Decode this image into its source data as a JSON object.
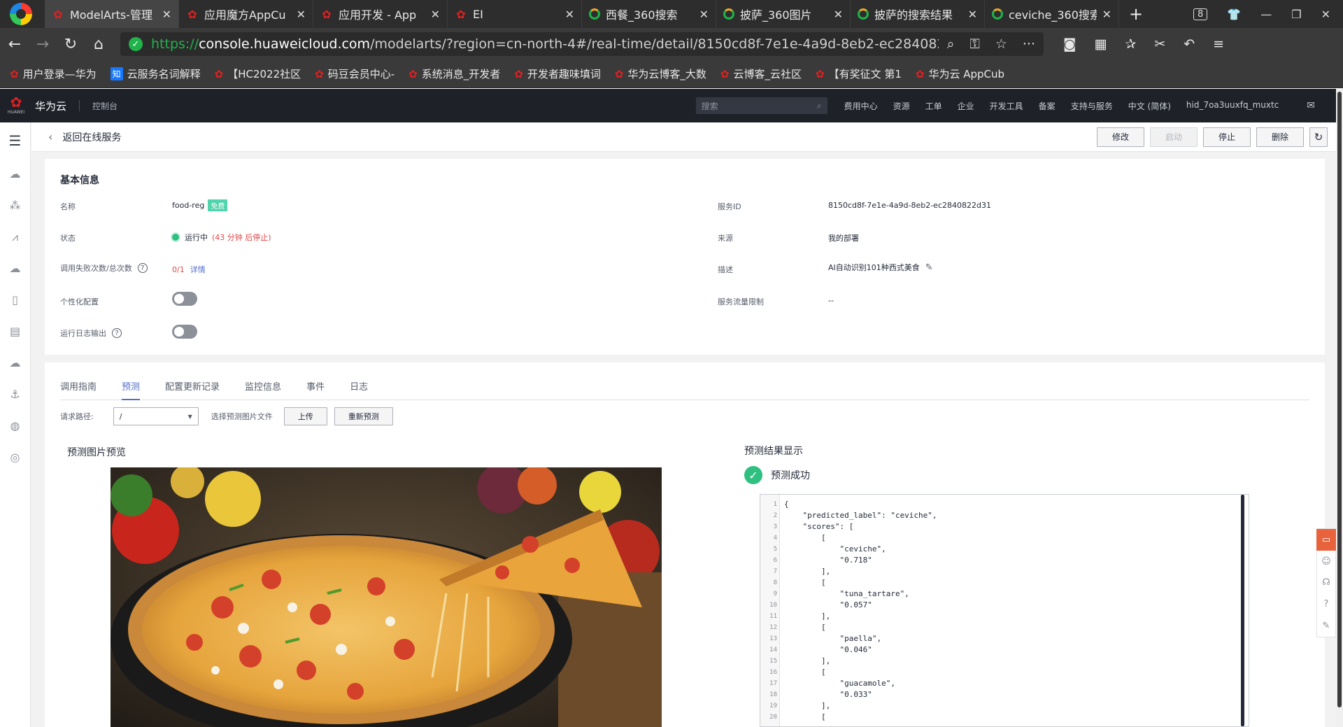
{
  "browser": {
    "tabs": [
      {
        "title": "ModelArts-管理",
        "icon": "huawei-icon",
        "active": true
      },
      {
        "title": "应用魔方AppCu",
        "icon": "huawei-icon"
      },
      {
        "title": "应用开发 - App",
        "icon": "huawei-icon"
      },
      {
        "title": "EI",
        "icon": "huawei-icon"
      },
      {
        "title": "西餐_360搜索",
        "icon": "360-search-icon"
      },
      {
        "title": "披萨_360图片",
        "icon": "360-search-icon"
      },
      {
        "title": "披萨的搜索结果",
        "icon": "360-search-icon"
      },
      {
        "title": "ceviche_360搜索",
        "icon": "360-search-icon"
      }
    ],
    "tab_count": "8",
    "url_proto": "https://",
    "url_host": "console.huaweicloud.com",
    "url_path": "/modelarts/?region=cn-north-4#/real-time/detail/8150cd8f-7e1e-4a9d-8eb2-ec2840822d31?action=infer",
    "bookmarks": [
      {
        "label": "用户登录—华为",
        "icon": "huawei-icon"
      },
      {
        "label": "云服务名词解释",
        "icon": "zhi-icon",
        "icon_text": "知"
      },
      {
        "label": "【HC2022社区",
        "icon": "huawei-icon"
      },
      {
        "label": "码豆会员中心-",
        "icon": "huawei-icon"
      },
      {
        "label": "系统消息_开发者",
        "icon": "huawei-icon"
      },
      {
        "label": "开发者趣味填词",
        "icon": "huawei-icon"
      },
      {
        "label": "华为云博客_大数",
        "icon": "huawei-icon"
      },
      {
        "label": "云博客_云社区",
        "icon": "huawei-icon"
      },
      {
        "label": "【有奖征文 第1",
        "icon": "huawei-icon"
      },
      {
        "label": "华为云 AppCub",
        "icon": "huawei-icon"
      }
    ]
  },
  "console": {
    "brand": "华为云",
    "logo_text": "HUAWEI",
    "console_label": "控制台",
    "search_placeholder": "搜索",
    "nav": [
      "费用中心",
      "资源",
      "工单",
      "企业",
      "开发工具",
      "备案",
      "支持与服务",
      "中文 (简体)",
      "hid_7oa3uuxfq_muxtc"
    ]
  },
  "page": {
    "back_label": "返回在线服务",
    "actions": {
      "edit": "修改",
      "start": "启动",
      "stop": "停止",
      "delete": "删除"
    }
  },
  "basic_info": {
    "title": "基本信息",
    "name_label": "名称",
    "name_value": "food-reg",
    "free_badge": "免费",
    "status_label": "状态",
    "status_value": "运行中",
    "status_note": "(43 分钟 后停止)",
    "calls_label": "调用失败次数/总次数",
    "calls_value": "0/1",
    "calls_link": "详情",
    "personal_label": "个性化配置",
    "log_label": "运行日志输出",
    "service_id_label": "服务ID",
    "service_id_value": "8150cd8f-7e1e-4a9d-8eb2-ec2840822d31",
    "source_label": "来源",
    "source_value": "我的部署",
    "desc_label": "描述",
    "desc_value": "AI自动识别101种西式美食",
    "limit_label": "服务流量限制",
    "limit_value": "--"
  },
  "tabs": [
    "调用指南",
    "预测",
    "配置更新记录",
    "监控信息",
    "事件",
    "日志"
  ],
  "active_tab": 1,
  "predict": {
    "path_label": "请求路径:",
    "path_value": "/",
    "pick_label": "选择预测图片文件",
    "upload": "上传",
    "repredict": "重新预测",
    "preview_title": "预测图片预览",
    "result_title": "预测结果显示",
    "success_text": "预测成功",
    "code_lines": [
      "{",
      "    \"predicted_label\": \"ceviche\",",
      "    \"scores\": [",
      "        [",
      "            \"ceviche\",",
      "            \"0.718\"",
      "        ],",
      "        [",
      "            \"tuna_tartare\",",
      "            \"0.057\"",
      "        ],",
      "        [",
      "            \"paella\",",
      "            \"0.046\"",
      "        ],",
      "        [",
      "            \"guacamole\",",
      "            \"0.033\"",
      "        ],",
      "        ["
    ]
  }
}
